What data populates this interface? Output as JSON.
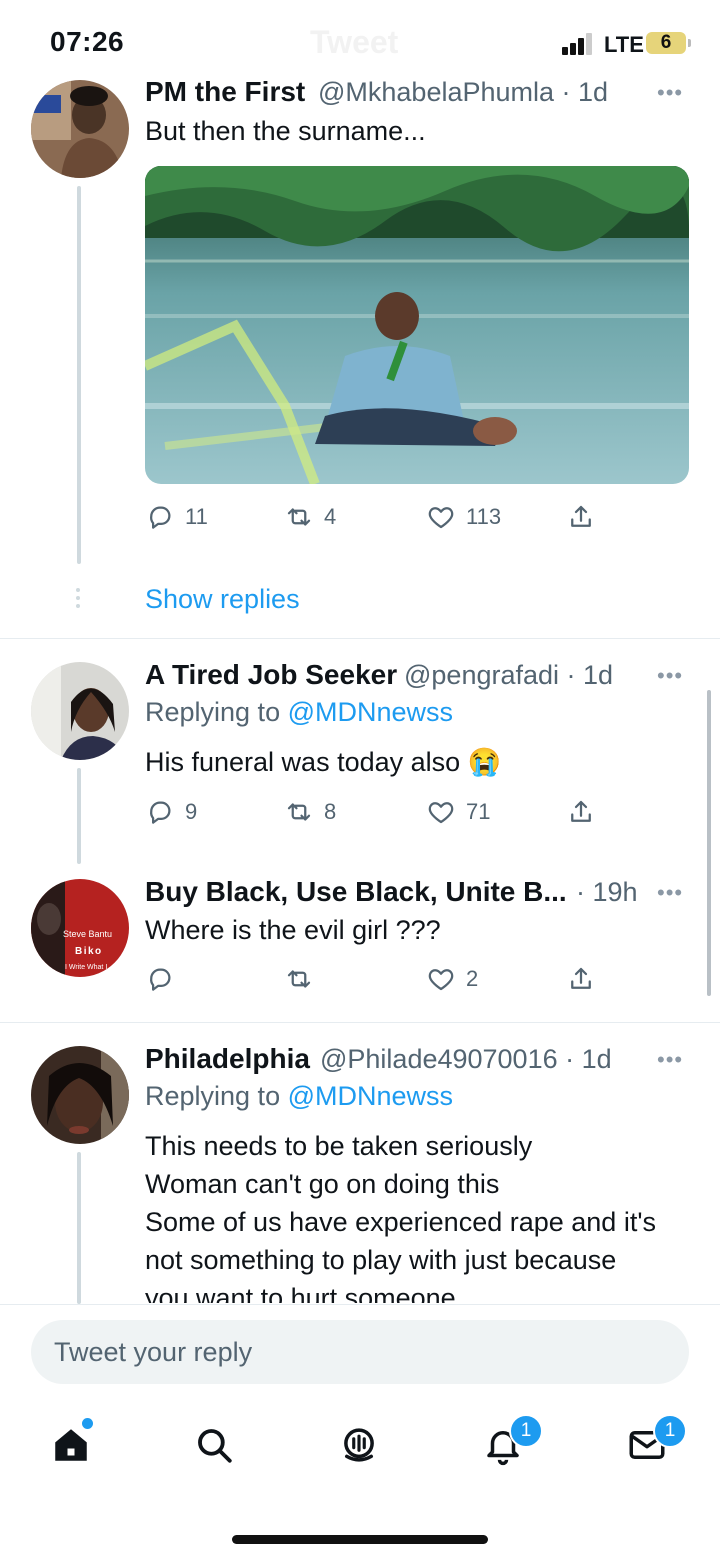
{
  "status_bar": {
    "time": "07:26",
    "network": "LTE",
    "battery": "6",
    "header_title_ghost": "Tweet"
  },
  "tweets": [
    {
      "name": "PM the First",
      "handle": "@MkhabelaPhumla",
      "time": "· 1d",
      "text": "But then the surname...",
      "reply_count": "11",
      "retweet_count": "4",
      "like_count": "113"
    },
    {
      "name": "A Tired Job Seeker",
      "handle": "@pengrafadi",
      "time": "· 1d",
      "replying_prefix": "Replying to",
      "replying_handle": "@MDNnewss",
      "text": "His funeral was today also 😭",
      "reply_count": "9",
      "retweet_count": "8",
      "like_count": "71"
    },
    {
      "name": "Buy Black, Use Black, Unite B...",
      "time": "· 19h",
      "text": "Where is the evil girl ???",
      "reply_count": "",
      "retweet_count": "",
      "like_count": "2",
      "avatar_lines": [
        "Steve Bantu",
        "Biko",
        "I Write What I"
      ]
    },
    {
      "name": "Philadelphia",
      "handle": "@Philade49070016",
      "time": "· 1d",
      "replying_prefix": "Replying to",
      "replying_handle": "@MDNnewss",
      "text_lines": [
        "This needs to be taken seriously",
        "Woman can't go on doing this",
        "Some of us have experienced rape and it's",
        "not something to play with just because",
        "you want to hurt someone"
      ]
    }
  ],
  "show_replies": "Show replies",
  "compose": {
    "placeholder": "Tweet your reply"
  },
  "nav": {
    "notifications_badge": "1",
    "messages_badge": "1"
  }
}
